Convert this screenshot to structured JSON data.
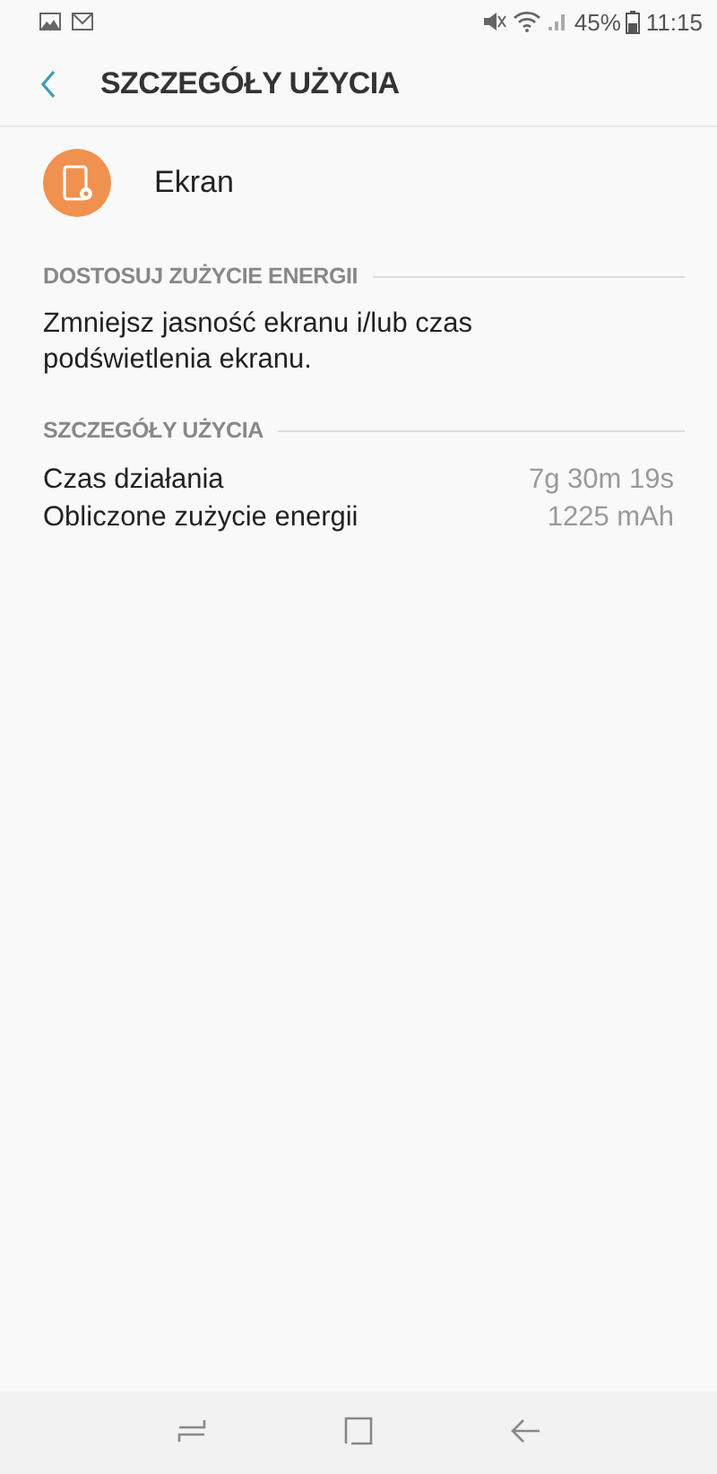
{
  "status_bar": {
    "battery": "45%",
    "time": "11:15"
  },
  "header": {
    "title": "SZCZEGÓŁY UŻYCIA"
  },
  "app": {
    "name": "Ekran"
  },
  "sections": [
    {
      "title": "DOSTOSUJ ZUŻYCIE ENERGII",
      "kind": "text",
      "text": "Zmniejsz jasność ekranu i/lub czas podświetlenia ekranu."
    },
    {
      "title": "SZCZEGÓŁY UŻYCIA",
      "kind": "rows",
      "rows": [
        {
          "label": "Czas działania",
          "value": "7g 30m 19s"
        },
        {
          "label": "Obliczone zużycie energii",
          "value": "1225 mAh"
        }
      ]
    }
  ]
}
